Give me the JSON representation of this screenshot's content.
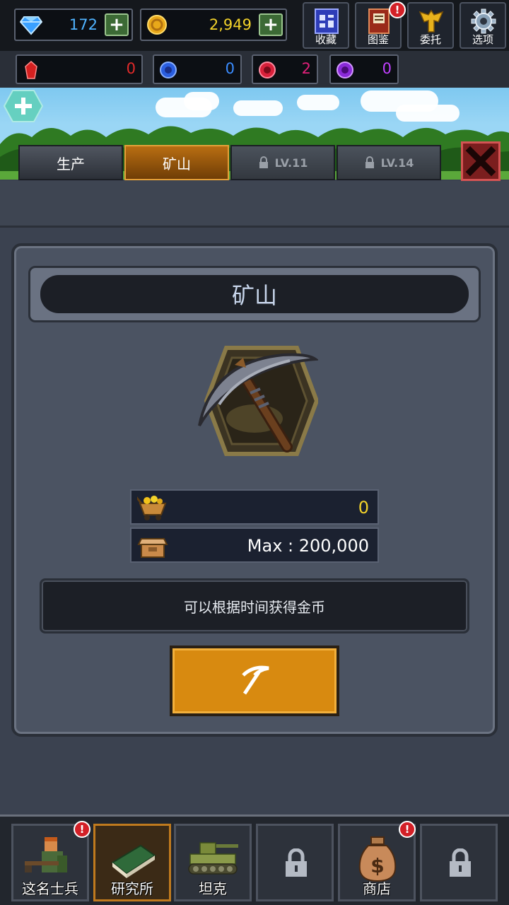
{
  "resources": {
    "diamonds": "172",
    "coins": "2,949"
  },
  "top_buttons": [
    {
      "label": "收藏",
      "icon": "collection-icon"
    },
    {
      "label": "图鉴",
      "icon": "codex-book-icon",
      "alert": "!"
    },
    {
      "label": "委托",
      "icon": "eagle-emblem-icon"
    },
    {
      "label": "选项",
      "icon": "gear-icon"
    }
  ],
  "gems": {
    "red": "0",
    "blue": "0",
    "crimson": "2",
    "purple": "0"
  },
  "tabs": {
    "production": "生产",
    "mine": "矿山",
    "locked1": "LV.11",
    "locked2": "LV.14"
  },
  "panel": {
    "title": "矿山",
    "mined_amount": "0",
    "capacity": "Max : 200,000",
    "description": "可以根据时间获得金币"
  },
  "bottom_nav": [
    {
      "label": "这名士兵",
      "icon": "soldier-icon",
      "alert": "!"
    },
    {
      "label": "研究所",
      "icon": "research-book-icon"
    },
    {
      "label": "坦克",
      "icon": "tank-icon"
    },
    {
      "label": "",
      "icon": "lock-icon"
    },
    {
      "label": "商店",
      "icon": "money-bag-icon",
      "alert": "!"
    },
    {
      "label": "",
      "icon": "lock-icon"
    }
  ],
  "colors": {
    "diamond_value": "#4fb3ff",
    "coin_value": "#f2d22a",
    "red_gem_value": "#e02a2a",
    "blue_gem_value": "#3a8cff",
    "crimson_gem_value": "#e0207a",
    "purple_gem_value": "#c040ff",
    "mined_value": "#f2d22a",
    "active_tab": "#b96e12",
    "mine_button": "#d88a10"
  }
}
